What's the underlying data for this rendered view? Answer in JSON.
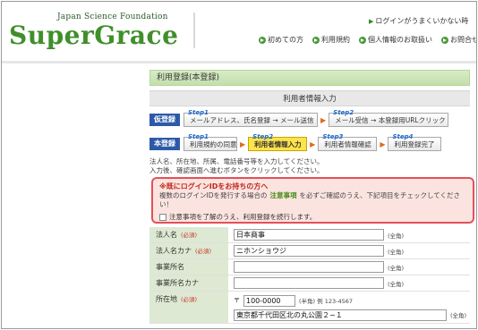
{
  "header": {
    "logo_sub": "Japan Science Foundation",
    "logo_main": "SuperGrace",
    "help_link": "ログインがうまくいかない時",
    "nav": [
      "初めての方",
      "利用規約",
      "個人情報のお取扱い",
      "お問合せ"
    ]
  },
  "page": {
    "section_title": "利用登録(本登録)",
    "subheading": "利用者情報入力"
  },
  "steps_provisional": {
    "badge": "仮登録",
    "steps": [
      {
        "label": "Step1",
        "text": "メールアドレス、氏名登録 → メール送信"
      },
      {
        "label": "Step2",
        "text": "メール受信 → 本登録用URLクリック"
      }
    ]
  },
  "steps_main": {
    "badge": "本登録",
    "steps": [
      {
        "label": "Step1",
        "text": "利用規約の同意"
      },
      {
        "label": "Step2",
        "text": "利用者情報入力"
      },
      {
        "label": "Step3",
        "text": "利用者情報確認"
      },
      {
        "label": "Step4",
        "text": "利用登録完了"
      }
    ],
    "active_index": 1
  },
  "instructions": [
    "法人名、所在地、所属、電話番号等を入力してください。",
    "入力後、確認画面へ進むボタンをクリックしてください。"
  ],
  "notice": {
    "title": "※既にログインIDをお持ちの方へ",
    "body_before": "複数のログインIDを発行する場合の",
    "body_em": "注意事項",
    "body_after": "を必ずご確認のうえ、下記項目をチェックしてください！",
    "checkbox_label": "注意事項を了解のうえ、利用登録を続行します。",
    "checked": false
  },
  "form": {
    "required_mark": "(必須)",
    "fields": [
      {
        "label": "法人名",
        "required": true,
        "value": "日本商事",
        "hint": "(全角)"
      },
      {
        "label": "法人名カナ",
        "required": true,
        "value": "ニホンショウジ",
        "hint": "(全角)"
      },
      {
        "label": "事業所名",
        "required": false,
        "value": "",
        "hint": "(全角)"
      },
      {
        "label": "事業所名カナ",
        "required": false,
        "value": "",
        "hint": "(全角)"
      }
    ],
    "address": {
      "label": "所在地",
      "required": true,
      "zip_prefix": "〒",
      "zip_value": "100-0000",
      "zip_hint": "(半角) 例 123-4567",
      "address_value": "東京都千代田区北の丸公園２−１",
      "address_hint": "(全角)"
    }
  },
  "colors": {
    "brand_green": "#3f8f2a",
    "badge_blue": "#2c5aa8",
    "active_step": "#ffe34a",
    "notice_border": "#e4505a",
    "required_red": "#d03030"
  }
}
